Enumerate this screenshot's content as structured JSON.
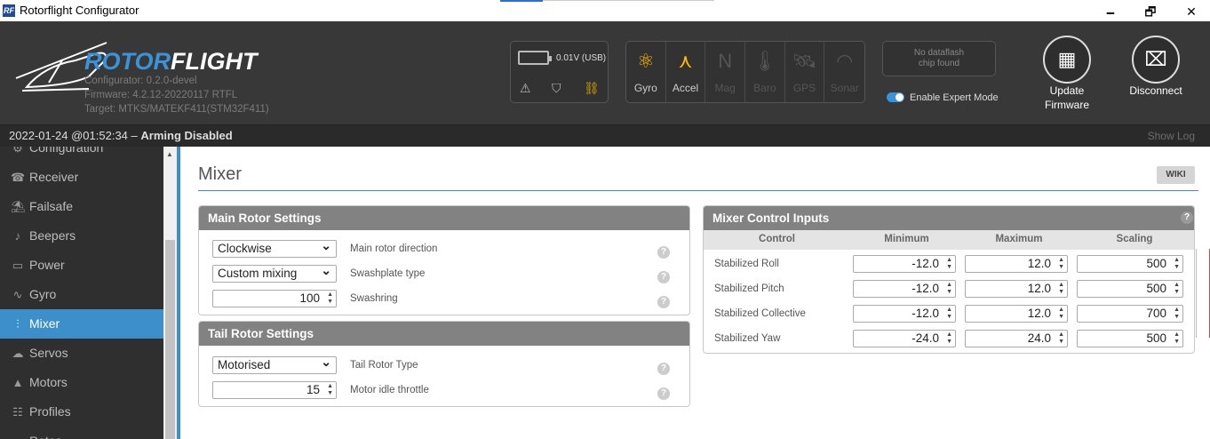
{
  "window": {
    "title": "Rotorflight Configurator",
    "app_icon": "RF",
    "minimize": "🗕",
    "restore": "🗗",
    "close": "✕"
  },
  "header": {
    "logo_rotor": "ROTOR",
    "logo_flight": "FLIGHT",
    "configurator": "Configurator: 0.2.0-devel",
    "firmware": "Firmware: 4.2.12-20220117 RTFL",
    "target": "Target: MTKS/MATEKF411(STM32F411)",
    "battery": "0.01V (USB)",
    "sensors": [
      {
        "label": "Gyro",
        "icon": "gyro-icon",
        "glyph": "⚛",
        "active": true
      },
      {
        "label": "Accel",
        "icon": "accel-icon",
        "glyph": "⋏",
        "active": true
      },
      {
        "label": "Mag",
        "icon": "mag-icon",
        "glyph": "N",
        "active": false
      },
      {
        "label": "Baro",
        "icon": "baro-icon",
        "glyph": "🌡",
        "active": false
      },
      {
        "label": "GPS",
        "icon": "gps-icon",
        "glyph": "🛰",
        "active": false
      },
      {
        "label": "Sonar",
        "icon": "sonar-icon",
        "glyph": "◠",
        "active": false
      }
    ],
    "dataflash_line1": "No dataflash",
    "dataflash_line2": "chip found",
    "expert_mode": "Enable Expert Mode",
    "update_line1": "Update",
    "update_line2": "Firmware",
    "disconnect": "Disconnect"
  },
  "status": {
    "time": "2022-01-24 @01:52:34",
    "separator": " – ",
    "arming": "Arming Disabled",
    "show_log": "Show Log"
  },
  "sidebar": {
    "items": [
      {
        "label": "Configuration",
        "glyph": "⚙",
        "icon": "configuration-icon",
        "active": false
      },
      {
        "label": "Receiver",
        "glyph": "☎",
        "icon": "receiver-icon",
        "active": false
      },
      {
        "label": "Failsafe",
        "glyph": "⛱",
        "icon": "failsafe-icon",
        "active": false
      },
      {
        "label": "Beepers",
        "glyph": "♪",
        "icon": "beepers-icon",
        "active": false
      },
      {
        "label": "Power",
        "glyph": "▭",
        "icon": "power-icon",
        "active": false
      },
      {
        "label": "Gyro",
        "glyph": "∿",
        "icon": "gyro-icon",
        "active": false
      },
      {
        "label": "Mixer",
        "glyph": "⫶",
        "icon": "mixer-icon",
        "active": true
      },
      {
        "label": "Servos",
        "glyph": "☁",
        "icon": "servos-icon",
        "active": false
      },
      {
        "label": "Motors",
        "glyph": "▲",
        "icon": "motors-icon",
        "active": false
      },
      {
        "label": "Profiles",
        "glyph": "☷",
        "icon": "profiles-icon",
        "active": false
      },
      {
        "label": "Rates",
        "glyph": "≡",
        "icon": "rates-icon",
        "active": false
      }
    ]
  },
  "page": {
    "title": "Mixer",
    "wiki": "WIKI"
  },
  "main_rotor": {
    "title": "Main Rotor Settings",
    "direction": {
      "value": "Clockwise",
      "label": "Main rotor direction"
    },
    "swashplate": {
      "value": "Custom mixing",
      "label": "Swashplate type"
    },
    "swashring": {
      "value": "100",
      "label": "Swashring"
    }
  },
  "tail_rotor": {
    "title": "Tail Rotor Settings",
    "type": {
      "value": "Motorised",
      "label": "Tail Rotor Type"
    },
    "idle": {
      "value": "15",
      "label": "Motor idle throttle"
    }
  },
  "mixer_inputs": {
    "title": "Mixer Control Inputs",
    "headers": [
      "Control",
      "Minimum",
      "Maximum",
      "Scaling"
    ],
    "rows": [
      {
        "control": "Stabilized Roll",
        "min": "-12.0",
        "max": "12.0",
        "scale": "500"
      },
      {
        "control": "Stabilized Pitch",
        "min": "-12.0",
        "max": "12.0",
        "scale": "500"
      },
      {
        "control": "Stabilized Collective",
        "min": "-12.0",
        "max": "12.0",
        "scale": "700"
      },
      {
        "control": "Stabilized Yaw",
        "min": "-24.0",
        "max": "24.0",
        "scale": "500"
      }
    ]
  },
  "help_glyph": "?",
  "accent": "#3d8fcc",
  "sensor_active_color": "#ffbb00"
}
